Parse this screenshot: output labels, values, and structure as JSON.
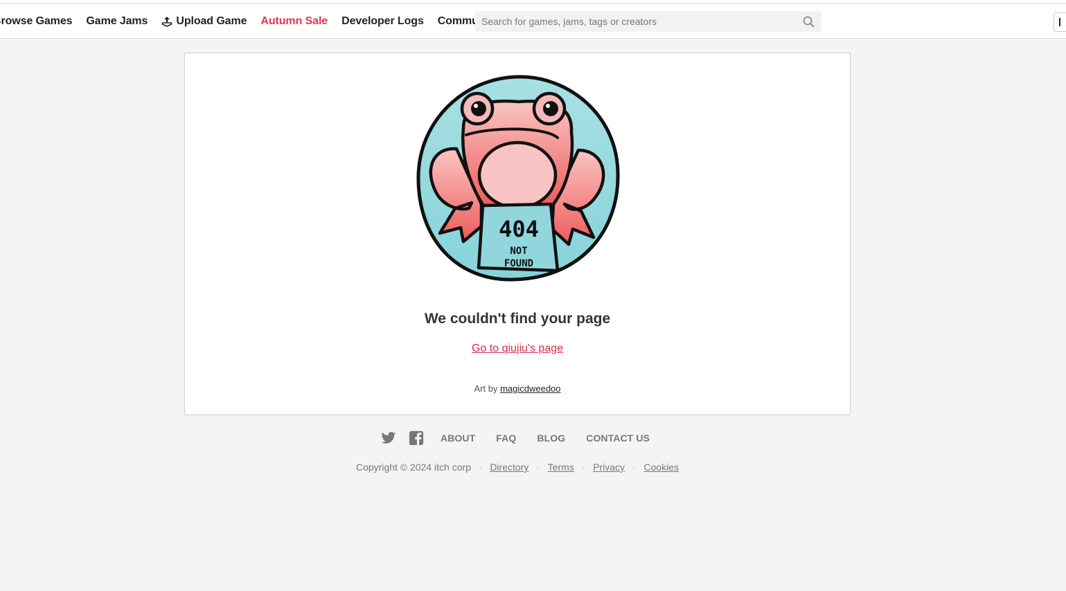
{
  "header": {
    "nav": [
      {
        "label": "Browse Games"
      },
      {
        "label": "Game Jams"
      },
      {
        "label": "Upload Game"
      },
      {
        "label": "Autumn Sale"
      },
      {
        "label": "Developer Logs"
      },
      {
        "label": "Community"
      }
    ],
    "search": {
      "placeholder": "Search for games, jams, tags or creators"
    }
  },
  "main": {
    "image_text": "404 NOT FOUND",
    "title": "We couldn't find your page",
    "goto_link": "Go to qiujiu's page",
    "art_by_prefix": "Art by",
    "artist": "magicdweedoo"
  },
  "footer": {
    "links": [
      "ABOUT",
      "FAQ",
      "BLOG",
      "CONTACT US"
    ],
    "copyright": "Copyright © 2024 itch corp",
    "bottom_links": [
      "Directory",
      "Terms",
      "Privacy",
      "Cookies"
    ]
  },
  "colors": {
    "accent": "#da2c49",
    "sale": "#e8344e",
    "frog_bg": "#8ed6dc",
    "frog_body": "#f07f82"
  },
  "icons": [
    "upload-icon",
    "search-icon",
    "twitter-icon",
    "facebook-icon"
  ]
}
